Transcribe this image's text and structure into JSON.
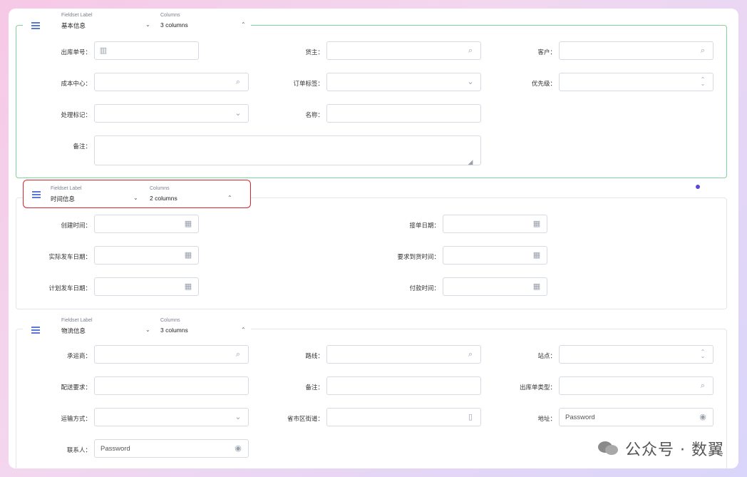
{
  "sections": [
    {
      "caption_label": "Fieldset Label",
      "caption_columns": "Columns",
      "label": "基本信息",
      "columns": "3 columns"
    },
    {
      "caption_label": "Fieldset Label",
      "caption_columns": "Columns",
      "label": "时间信息",
      "columns": "2 columns"
    },
    {
      "caption_label": "Fieldset Label",
      "caption_columns": "Columns",
      "label": "物流信息",
      "columns": "3 columns"
    }
  ],
  "basic": {
    "order_no": "出库单号：",
    "owner": "货主：",
    "customer": "客户：",
    "cost_center": "成本中心：",
    "order_tag": "订单标签：",
    "priority": "优先级：",
    "handle_flag": "处理标记：",
    "name": "名称：",
    "remark": "备注："
  },
  "time": {
    "created": "创建时间：",
    "received": "接单日期：",
    "actual_ship": "实际发车日期：",
    "required_arrival": "要求到货时间：",
    "planned_ship": "计划发车日期：",
    "pay_time": "付款时间："
  },
  "logistics": {
    "carrier": "承运商：",
    "route": "路线：",
    "station": "站点：",
    "delivery_req": "配送要求：",
    "remark": "备注：",
    "order_type": "出库单类型：",
    "transport": "运输方式：",
    "region": "省市区街道：",
    "address": "地址：",
    "contact": "联系人：",
    "password_placeholder": "Password"
  },
  "watermark": "公众号 · 数翼",
  "icons": {
    "search": "search-icon",
    "chevron": "chevron-down-icon",
    "calendar": "calendar-icon",
    "eye": "eye-icon",
    "map": "map-icon",
    "barcode": "barcode-icon",
    "stepper": "stepper-icon",
    "menu": "menu-icon"
  },
  "colors": {
    "accent": "#5b78d9",
    "selected_border": "#d9242b",
    "active_fieldset": "#7fd49a"
  }
}
